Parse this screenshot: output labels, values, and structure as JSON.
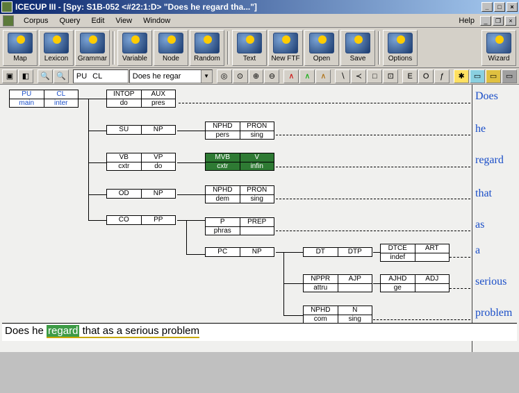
{
  "window": {
    "title": "ICECUP III - [Spy: S1B-052 <#22:1:D> \"Does he regard tha...\"]"
  },
  "menu": {
    "items": [
      "Corpus",
      "Query",
      "Edit",
      "View",
      "Window"
    ],
    "right": "Help"
  },
  "toolbar": {
    "buttons": [
      "Map",
      "Lexicon",
      "Grammar",
      "Variable",
      "Node",
      "Random",
      "Text",
      "New FTF",
      "Open",
      "Save",
      "Options"
    ],
    "rightButton": "Wizard"
  },
  "smallbar": {
    "seg1": "PU",
    "seg2": "CL",
    "combo": "Does he regar"
  },
  "tree": {
    "root": {
      "top": [
        "PU",
        "CL"
      ],
      "bot": [
        "main",
        "inter"
      ]
    },
    "n_intop": {
      "top": [
        "INTOP",
        "AUX"
      ],
      "bot": [
        "do",
        "pres"
      ]
    },
    "n_su": {
      "top": [
        "SU",
        "NP"
      ]
    },
    "n_vb": {
      "top": [
        "VB",
        "VP"
      ],
      "bot": [
        "cxtr",
        "do"
      ]
    },
    "n_od": {
      "top": [
        "OD",
        "NP"
      ]
    },
    "n_co": {
      "top": [
        "CO",
        "PP"
      ]
    },
    "n_nphd1": {
      "top": [
        "NPHD",
        "PRON"
      ],
      "bot": [
        "pers",
        "sing"
      ]
    },
    "n_mvb": {
      "top": [
        "MVB",
        "V"
      ],
      "bot": [
        "cxtr",
        "infin"
      ]
    },
    "n_nphd2": {
      "top": [
        "NPHD",
        "PRON"
      ],
      "bot": [
        "dem",
        "sing"
      ]
    },
    "n_p": {
      "top": [
        "P",
        "PREP"
      ],
      "bot": [
        "phras",
        ""
      ]
    },
    "n_pc": {
      "top": [
        "PC",
        "NP"
      ]
    },
    "n_dt": {
      "top": [
        "DT",
        "DTP"
      ]
    },
    "n_nppr": {
      "top": [
        "NPPR",
        "AJP"
      ],
      "bot": [
        "attru",
        ""
      ]
    },
    "n_nphd3": {
      "top": [
        "NPHD",
        "N"
      ],
      "bot": [
        "com",
        "sing"
      ]
    },
    "n_dtce": {
      "top": [
        "DTCE",
        "ART"
      ],
      "bot": [
        "indef",
        ""
      ]
    },
    "n_ajhd": {
      "top": [
        "AJHD",
        "ADJ"
      ],
      "bot": [
        "ge",
        ""
      ]
    }
  },
  "words": [
    "Does",
    "he",
    "regard",
    "that",
    "as",
    "a",
    "serious",
    "problem"
  ],
  "sentence": {
    "pre": "Does he ",
    "highlight": "regard",
    "post": " that as a serious problem"
  }
}
